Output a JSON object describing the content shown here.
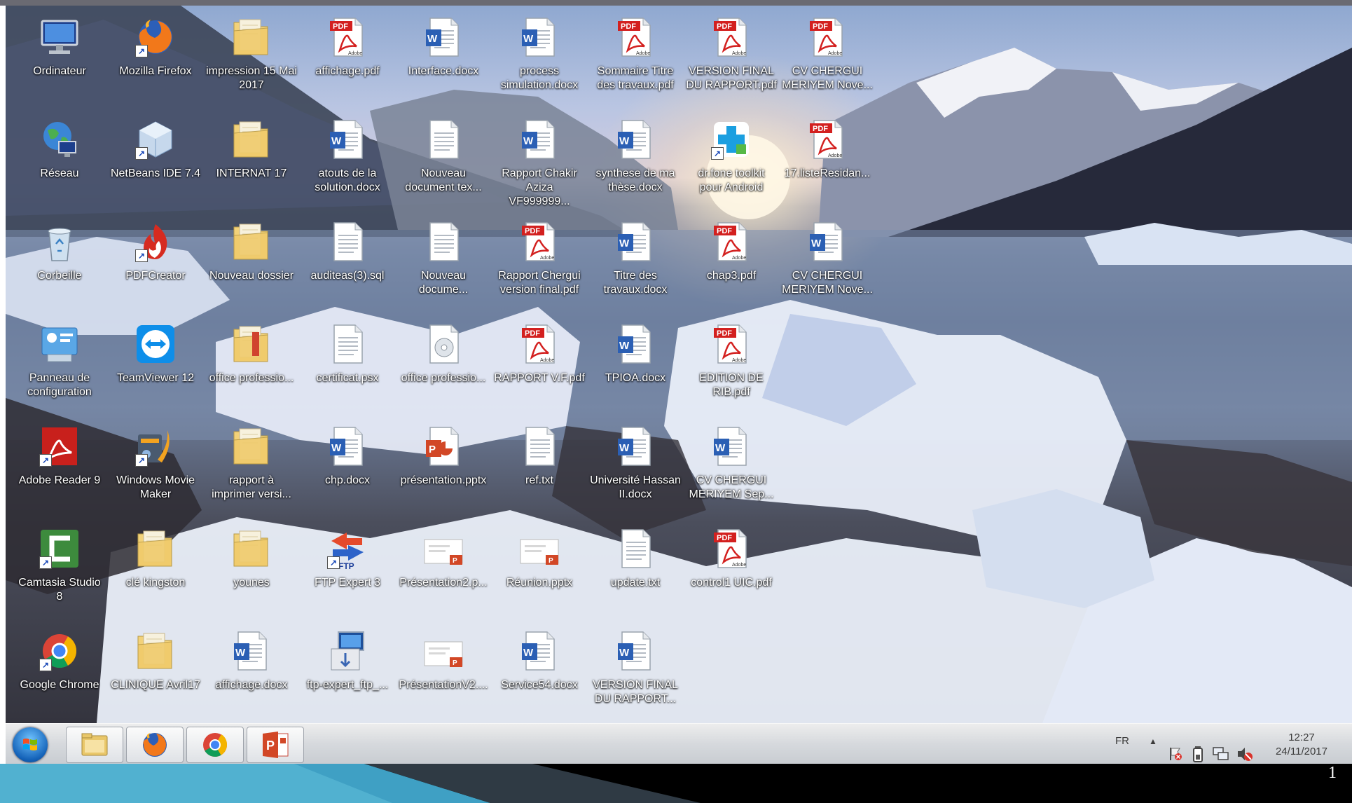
{
  "desktop": {
    "icons": [
      {
        "label": "Ordinateur",
        "type": "computer",
        "col": 0,
        "row": 0
      },
      {
        "label": "Mozilla Firefox",
        "type": "firefox",
        "col": 1,
        "row": 0,
        "shortcut": true
      },
      {
        "label": "impression 15 Mai 2017",
        "type": "folder",
        "col": 2,
        "row": 0
      },
      {
        "label": "affichage.pdf",
        "type": "pdf",
        "col": 3,
        "row": 0
      },
      {
        "label": "Interface.docx",
        "type": "word",
        "col": 4,
        "row": 0
      },
      {
        "label": "process simulation.docx",
        "type": "word",
        "col": 5,
        "row": 0
      },
      {
        "label": "Sommaire Titre des travaux.pdf",
        "type": "pdf",
        "col": 6,
        "row": 0
      },
      {
        "label": "VERSION FINAL DU RAPPORT.pdf",
        "type": "pdf",
        "col": 7,
        "row": 0
      },
      {
        "label": "CV CHERGUI MERIYEM Nove...",
        "type": "pdf",
        "col": 8,
        "row": 0
      },
      {
        "label": "Réseau",
        "type": "network",
        "col": 0,
        "row": 1
      },
      {
        "label": "NetBeans IDE 7.4",
        "type": "netbeans",
        "col": 1,
        "row": 1,
        "shortcut": true
      },
      {
        "label": "INTERNAT 17",
        "type": "folder",
        "col": 2,
        "row": 1
      },
      {
        "label": "atouts de la solution.docx",
        "type": "word",
        "col": 3,
        "row": 1
      },
      {
        "label": "Nouveau document tex...",
        "type": "text",
        "col": 4,
        "row": 1
      },
      {
        "label": "Rapport Chakir Aziza VF999999...",
        "type": "word",
        "col": 5,
        "row": 1
      },
      {
        "label": "synthese de ma thèse.docx",
        "type": "word",
        "col": 6,
        "row": 1
      },
      {
        "label": "dr.fone toolkit pour Android",
        "type": "drfone",
        "col": 7,
        "row": 1,
        "shortcut": true
      },
      {
        "label": "17.listeResidan...",
        "type": "pdf",
        "col": 8,
        "row": 1
      },
      {
        "label": "Corbeille",
        "type": "recycle",
        "col": 0,
        "row": 2
      },
      {
        "label": "PDFCreator",
        "type": "pdfcreator",
        "col": 1,
        "row": 2,
        "shortcut": true
      },
      {
        "label": "Nouveau dossier",
        "type": "folder",
        "col": 2,
        "row": 2
      },
      {
        "label": "auditeas(3).sql",
        "type": "text",
        "col": 3,
        "row": 2
      },
      {
        "label": "Nouveau docume...",
        "type": "text",
        "col": 4,
        "row": 2
      },
      {
        "label": "Rapport Chergui version final.pdf",
        "type": "pdf",
        "col": 5,
        "row": 2
      },
      {
        "label": "Titre des travaux.docx",
        "type": "word",
        "col": 6,
        "row": 2
      },
      {
        "label": "chap3.pdf",
        "type": "pdf",
        "col": 7,
        "row": 2
      },
      {
        "label": "CV CHERGUI MERIYEM Nove...",
        "type": "word",
        "col": 8,
        "row": 2
      },
      {
        "label": "Panneau de configuration",
        "type": "control",
        "col": 0,
        "row": 3
      },
      {
        "label": "TeamViewer 12",
        "type": "teamviewer",
        "col": 1,
        "row": 3
      },
      {
        "label": "office professio...",
        "type": "folder-red",
        "col": 2,
        "row": 3
      },
      {
        "label": "certificat.psx",
        "type": "text",
        "col": 3,
        "row": 3
      },
      {
        "label": "office professio...",
        "type": "disc",
        "col": 4,
        "row": 3
      },
      {
        "label": "RAPPORT V.F.pdf",
        "type": "pdf",
        "col": 5,
        "row": 3
      },
      {
        "label": "TPIOA.docx",
        "type": "word",
        "col": 6,
        "row": 3
      },
      {
        "label": "EDITION DE RIB.pdf",
        "type": "pdf",
        "col": 7,
        "row": 3
      },
      {
        "label": "Adobe Reader 9",
        "type": "adobe",
        "col": 0,
        "row": 4,
        "shortcut": true
      },
      {
        "label": "Windows Movie Maker",
        "type": "moviemaker",
        "col": 1,
        "row": 4,
        "shortcut": true
      },
      {
        "label": "rapport à imprimer versi...",
        "type": "folder",
        "col": 2,
        "row": 4
      },
      {
        "label": "chp.docx",
        "type": "word",
        "col": 3,
        "row": 4
      },
      {
        "label": "présentation.pptx",
        "type": "ppt",
        "col": 4,
        "row": 4
      },
      {
        "label": "ref.txt",
        "type": "text",
        "col": 5,
        "row": 4
      },
      {
        "label": "Université Hassan II.docx",
        "type": "word",
        "col": 6,
        "row": 4
      },
      {
        "label": "CV CHERGUI MERIYEM Sep...",
        "type": "word",
        "col": 7,
        "row": 4
      },
      {
        "label": "Camtasia Studio 8",
        "type": "camtasia",
        "col": 0,
        "row": 5,
        "shortcut": true
      },
      {
        "label": "clé kingston",
        "type": "folder",
        "col": 1,
        "row": 5
      },
      {
        "label": "younes",
        "type": "folder",
        "col": 2,
        "row": 5
      },
      {
        "label": "FTP Expert 3",
        "type": "ftp",
        "col": 3,
        "row": 5,
        "shortcut": true
      },
      {
        "label": "Présentation2.p...",
        "type": "pptslide",
        "col": 4,
        "row": 5
      },
      {
        "label": "Réunion.pptx",
        "type": "pptslide",
        "col": 5,
        "row": 5
      },
      {
        "label": "update.txt",
        "type": "text",
        "col": 6,
        "row": 5
      },
      {
        "label": "control1 UIC.pdf",
        "type": "pdf",
        "col": 7,
        "row": 5
      },
      {
        "label": "Google Chrome",
        "type": "chrome",
        "col": 0,
        "row": 6,
        "shortcut": true
      },
      {
        "label": "CLINIQUE Avril17",
        "type": "folder",
        "col": 1,
        "row": 6
      },
      {
        "label": "affichage.docx",
        "type": "word",
        "col": 2,
        "row": 6
      },
      {
        "label": "ftp-expert_ftp_...",
        "type": "installer",
        "col": 3,
        "row": 6
      },
      {
        "label": "PrésentationV2....",
        "type": "pptslide",
        "col": 4,
        "row": 6
      },
      {
        "label": "Service54.docx",
        "type": "word",
        "col": 5,
        "row": 6
      },
      {
        "label": "VERSION FINAL DU RAPPORT...",
        "type": "word",
        "col": 6,
        "row": 6
      }
    ]
  },
  "taskbar": {
    "pinned": [
      {
        "name": "explorer",
        "icon": "folder-icon"
      },
      {
        "name": "firefox",
        "icon": "firefox-icon"
      },
      {
        "name": "chrome",
        "icon": "chrome-icon"
      },
      {
        "name": "powerpoint",
        "icon": "powerpoint-icon"
      }
    ],
    "tray": {
      "language": "FR",
      "time": "12:27",
      "date": "24/11/2017"
    }
  },
  "slide": {
    "page_number": "1"
  },
  "colors": {
    "pdf_red": "#d3201f",
    "word_blue": "#2b5fb4",
    "folder_yellow": "#f2d27a",
    "taskbar": "#d6d9dd",
    "slide_accent": "#3fa0c4"
  }
}
